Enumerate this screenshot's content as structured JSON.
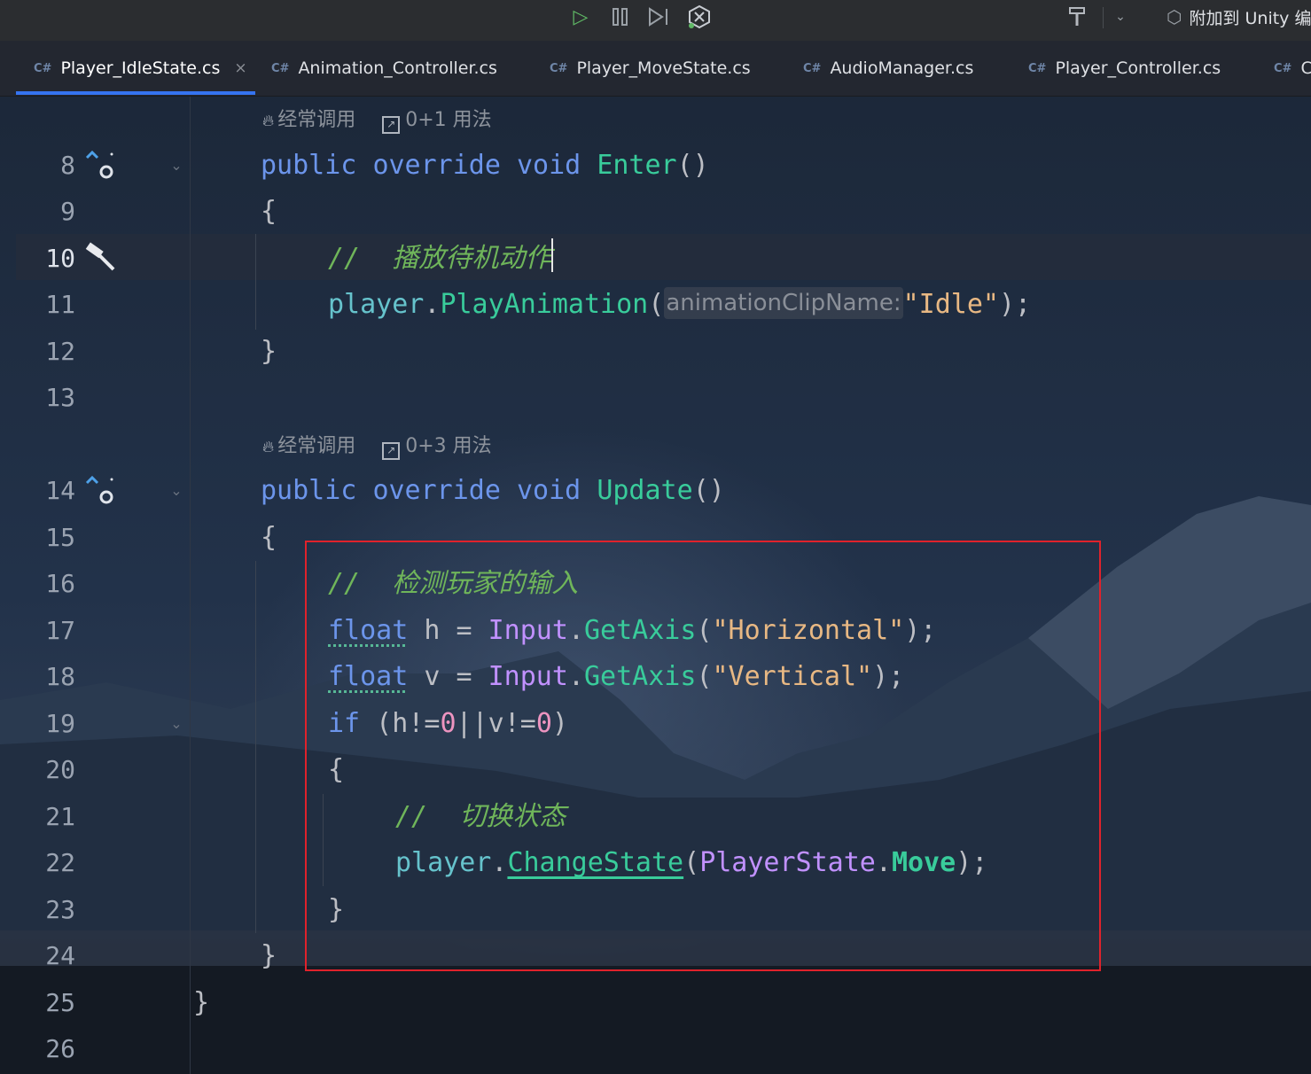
{
  "toolbar": {
    "icons": [
      "run-icon",
      "pause-icon",
      "step-icon",
      "unity-debug-icon",
      "brush-icon",
      "chevron-down-icon"
    ],
    "attach_label": "附加到 Unity 编"
  },
  "tabs": [
    {
      "lang": "C#",
      "label": "Player_IdleState.cs",
      "active": true,
      "close": "×"
    },
    {
      "lang": "C#",
      "label": "Animation_Controller.cs"
    },
    {
      "lang": "C#",
      "label": "Player_MoveState.cs"
    },
    {
      "lang": "C#",
      "label": "AudioManager.cs"
    },
    {
      "lang": "C#",
      "label": "Player_Controller.cs"
    },
    {
      "lang": "C#",
      "label": "C"
    }
  ],
  "hints": [
    {
      "frequency": "经常调用",
      "usages": "0+1 用法"
    },
    {
      "frequency": "经常调用",
      "usages": "0+3 用法"
    }
  ],
  "line_numbers": [
    "8",
    "9",
    "10",
    "11",
    "12",
    "13",
    "14",
    "15",
    "16",
    "17",
    "18",
    "19",
    "20",
    "21",
    "22",
    "23",
    "24",
    "25",
    "26"
  ],
  "code": {
    "l8": {
      "public": "public",
      "override": "override",
      "void": "void",
      "name": "Enter",
      "rest": "()"
    },
    "l9": "{",
    "l10": {
      "slashes": "//",
      "text": "播放待机动作"
    },
    "l11": {
      "obj": "player",
      "dot": ".",
      "method": "PlayAnimation",
      "open": "(",
      "inlay": "animationClipName:",
      "arg": "\"Idle\"",
      "close": ");"
    },
    "l12": "}",
    "l14": {
      "public": "public",
      "override": "override",
      "void": "void",
      "name": "Update",
      "rest": "()"
    },
    "l15": "{",
    "l16": {
      "slashes": "//",
      "text": "检测玩家的输入"
    },
    "l17": {
      "type": "float",
      "var": " h = ",
      "cls": "Input",
      "dot": ".",
      "method": "GetAxis",
      "open": "(",
      "arg": "\"Horizontal\"",
      "close": ");"
    },
    "l18": {
      "type": "float",
      "var": " v = ",
      "cls": "Input",
      "dot": ".",
      "method": "GetAxis",
      "open": "(",
      "arg": "\"Vertical\"",
      "close": ");"
    },
    "l19": {
      "kw": "if",
      "a": " (h!=",
      "n1": "0",
      "b": "||v!=",
      "n2": "0",
      "c": ")"
    },
    "l20": "{",
    "l21": {
      "slashes": "//",
      "text": "切换状态"
    },
    "l22": {
      "obj": "player",
      "dot": ".",
      "method": "ChangeState",
      "open": "(",
      "cls": "PlayerState",
      "dot2": ".",
      "member": "Move",
      "close": ");"
    },
    "l23": "}",
    "l24": "}",
    "l25": "}"
  },
  "colors": {
    "keyword": "#6c95eb",
    "method": "#39cc9b",
    "class": "#c191ff",
    "string": "#e8b883",
    "number": "#ed94c0",
    "comment": "#6fb55a",
    "highlight_box": "#e0222b",
    "tab_accent": "#3574f0"
  }
}
